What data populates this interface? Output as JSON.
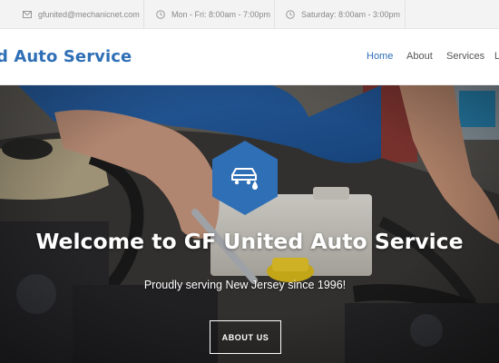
{
  "topbar": {
    "email": "gfunited@mechanicnet.com",
    "hours_weekday": "Mon - Fri: 8:00am - 7:00pm",
    "hours_saturday": "Saturday: 8:00am - 3:00pm"
  },
  "header": {
    "logo_text": "d Auto Service",
    "nav": [
      "Home",
      "About",
      "Services",
      "L"
    ],
    "active_nav": "Home"
  },
  "hero": {
    "title": "Welcome to GF United Auto Service",
    "subtitle": "Proudly serving New Jersey since 1996!",
    "button_label": "ABOUT US",
    "badge_icon": "car-oil-drop-icon"
  },
  "colors": {
    "brand": "#2f6fb6",
    "topbar_bg": "#f3f3f3",
    "nav_text": "#555555"
  }
}
